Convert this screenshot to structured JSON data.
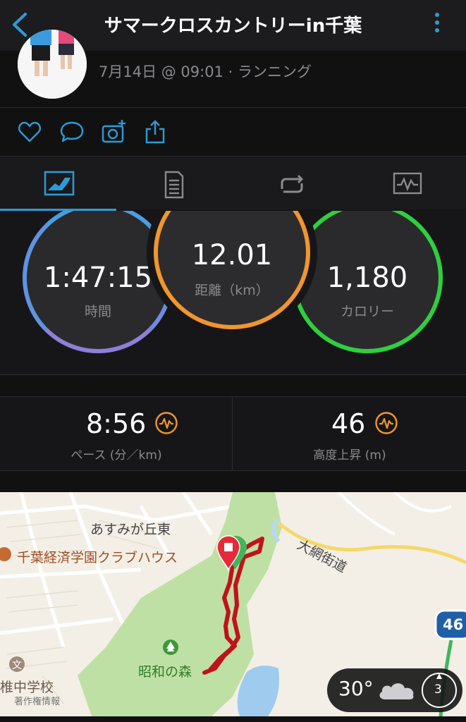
{
  "header": {
    "title": "サマークロスカントリーin千葉",
    "back_icon": "chevron-left-icon",
    "menu_icon": "kebab-menu-icon",
    "accent_color": "#2e9bd6"
  },
  "activity": {
    "date_line": "7月14日 @ 09:01 · ランニング"
  },
  "actions": [
    "heart-icon",
    "comment-icon",
    "add-photo-icon",
    "share-icon"
  ],
  "tabs": [
    {
      "icon": "stats-overview-icon",
      "active": true
    },
    {
      "icon": "details-list-icon",
      "active": false
    },
    {
      "icon": "laps-icon",
      "active": false
    },
    {
      "icon": "charts-icon",
      "active": false
    }
  ],
  "rings": {
    "time": {
      "value": "1:47:15",
      "label": "時間",
      "color": "#8f7fd8"
    },
    "distance": {
      "value": "12.01",
      "label": "距離（km）",
      "color": "#f0962e"
    },
    "calories": {
      "value": "1,180",
      "label": "カロリー",
      "color": "#2fcf3f"
    }
  },
  "metrics": {
    "pace": {
      "value": "8:56",
      "label": "ペース (分／km)",
      "icon": "activity-pulse-icon"
    },
    "elevation": {
      "value": "46",
      "label": "高度上昇 (m)",
      "icon": "activity-pulse-icon"
    }
  },
  "map": {
    "labels": {
      "area1": "あすみが丘東",
      "clubhouse": "千葉経済学園クラブハウス",
      "road": "大網街道",
      "park": "昭和の森",
      "school": "椎中学校",
      "copyright": "著作権情報",
      "route_number": "46"
    },
    "route_color": "#c0121b"
  },
  "weather": {
    "temperature": "30°",
    "icon": "cloud-icon",
    "wind_value": "3",
    "wind_icon": "compass-icon"
  }
}
